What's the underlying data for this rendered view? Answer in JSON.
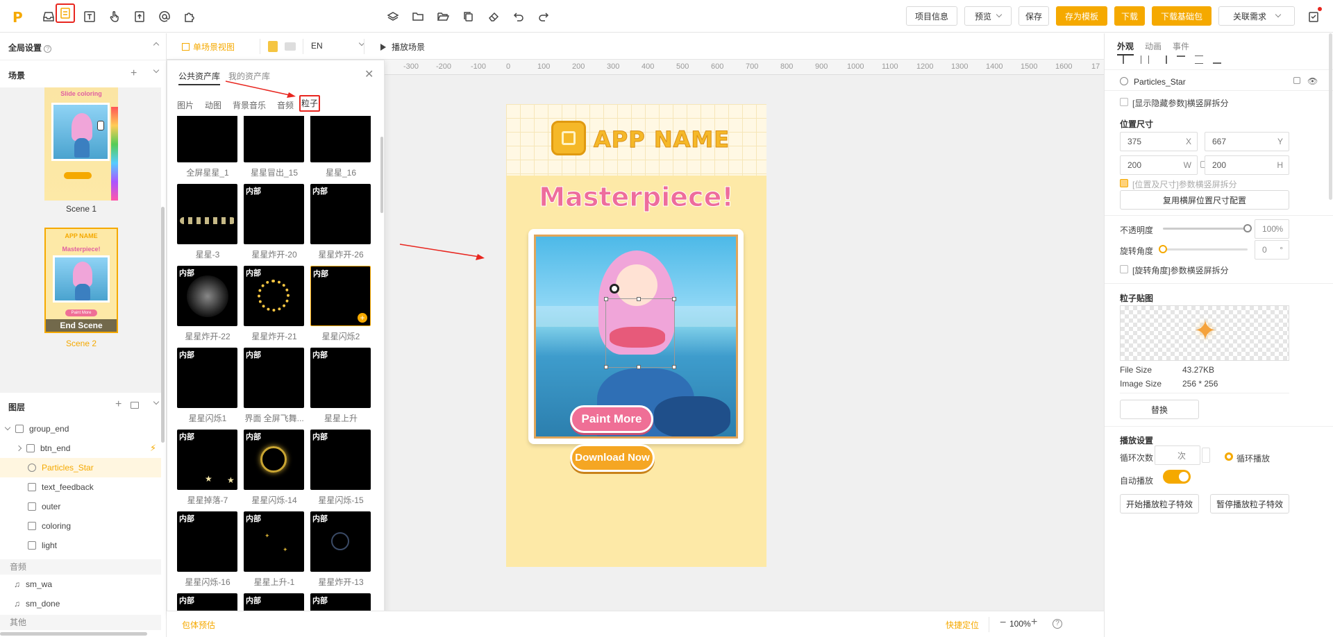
{
  "toolbar": {
    "project_info": "项目信息",
    "preview": "预览",
    "save": "保存",
    "save_template": "存为模板",
    "download": "下载",
    "download_base": "下载基础包",
    "related_requirement": "关联需求"
  },
  "left_panel": {
    "global_settings": "全局设置",
    "scenes_title": "场景",
    "scenes": [
      {
        "label": "Scene 1",
        "thumb_title": "Slide coloring"
      },
      {
        "label": "Scene 2",
        "thumb_title": "APP NAME",
        "overlay": "End Scene",
        "thumb_subtitle": "Masterpiece!",
        "thumb_button": "Paint More"
      }
    ],
    "layers_title": "图层",
    "layers": [
      {
        "name": "group_end",
        "icon": "folder-icon"
      },
      {
        "name": "btn_end",
        "icon": "folder-icon"
      },
      {
        "name": "Particles_Star",
        "icon": "particles-icon"
      },
      {
        "name": "text_feedback",
        "icon": "text-icon"
      },
      {
        "name": "outer",
        "icon": "image-icon"
      },
      {
        "name": "coloring",
        "icon": "image-icon"
      },
      {
        "name": "light",
        "icon": "image-icon"
      }
    ],
    "audio_title": "音频",
    "audio": [
      {
        "name": "sm_wa"
      },
      {
        "name": "sm_done"
      }
    ],
    "other_title": "其他"
  },
  "canvas_bar": {
    "single_scene_view": "单场景视图",
    "language": "EN",
    "play_scene": "播放场景"
  },
  "asset_panel": {
    "tabs": [
      "公共资产库",
      "我的资产库"
    ],
    "categories": [
      "图片",
      "动图",
      "背景音乐",
      "音频",
      "粒子"
    ],
    "tag": "内部",
    "items": [
      {
        "label": "全屏星星_1",
        "tag": false
      },
      {
        "label": "星星冒出_15",
        "tag": false
      },
      {
        "label": "星星_16",
        "tag": false
      },
      {
        "label": "星星-3",
        "tag": false
      },
      {
        "label": "星星炸开-20",
        "tag": true
      },
      {
        "label": "星星炸开-26",
        "tag": true
      },
      {
        "label": "星星炸开-22",
        "tag": true
      },
      {
        "label": "星星炸开-21",
        "tag": true
      },
      {
        "label": "星星闪烁2",
        "tag": true
      },
      {
        "label": "星星闪烁1",
        "tag": true
      },
      {
        "label": "界面 全屏飞舞...",
        "tag": true
      },
      {
        "label": "星星上升",
        "tag": true
      },
      {
        "label": "星星掉落-7",
        "tag": true
      },
      {
        "label": "星星闪烁-14",
        "tag": true
      },
      {
        "label": "星星闪烁-15",
        "tag": true
      },
      {
        "label": "星星闪烁-16",
        "tag": true
      },
      {
        "label": "星星上升-1",
        "tag": true
      },
      {
        "label": "星星炸开-13",
        "tag": true
      }
    ]
  },
  "ruler": [
    "-300",
    "-200",
    "-100",
    "0",
    "100",
    "200",
    "300",
    "400",
    "500",
    "600",
    "700",
    "800",
    "900",
    "1000",
    "1100",
    "1200",
    "1300",
    "1400",
    "1500",
    "1600",
    "17"
  ],
  "stage": {
    "app_name": "APP NAME",
    "headline": "Masterpiece!",
    "paint_more": "Paint More",
    "download_now": "Download Now"
  },
  "right_panel": {
    "tabs": [
      "外观",
      "动画",
      "事件"
    ],
    "element_name": "Particles_Star",
    "show_hidden": "[显示隐藏参数]横竖屏拆分",
    "position_size": "位置尺寸",
    "x_value": "375",
    "x_label": "X",
    "y_value": "667",
    "y_label": "Y",
    "w_value": "200",
    "w_label": "W",
    "h_value": "200",
    "h_label": "H",
    "pos_split": "[位置及尺寸]参数横竖屏拆分",
    "reuse_landscape": "复用横屏位置尺寸配置",
    "opacity_label": "不透明度",
    "opacity_value": "100",
    "opacity_unit": "%",
    "rotation_label": "旋转角度",
    "rotation_value": "0",
    "rotation_unit": "°",
    "rotation_split": "[旋转角度]参数横竖屏拆分",
    "particle_texture": "粒子贴图",
    "file_size_label": "File Size",
    "file_size_value": "43.27KB",
    "image_size_label": "Image Size",
    "image_size_value": "256 * 256",
    "replace": "替换",
    "playback_settings": "播放设置",
    "loop_count": "循环次数",
    "loop_unit": "次",
    "loop_play": "循环播放",
    "autoplay": "自动播放",
    "start_particles": "开始播放粒子特效",
    "pause_particles": "暂停播放粒子特效"
  },
  "bottom_bar": {
    "package_estimate": "包体预估",
    "quick_locate": "快捷定位",
    "zoom": "100%"
  },
  "colors": {
    "accent": "#f5a900",
    "highlight": "#e8261f"
  }
}
